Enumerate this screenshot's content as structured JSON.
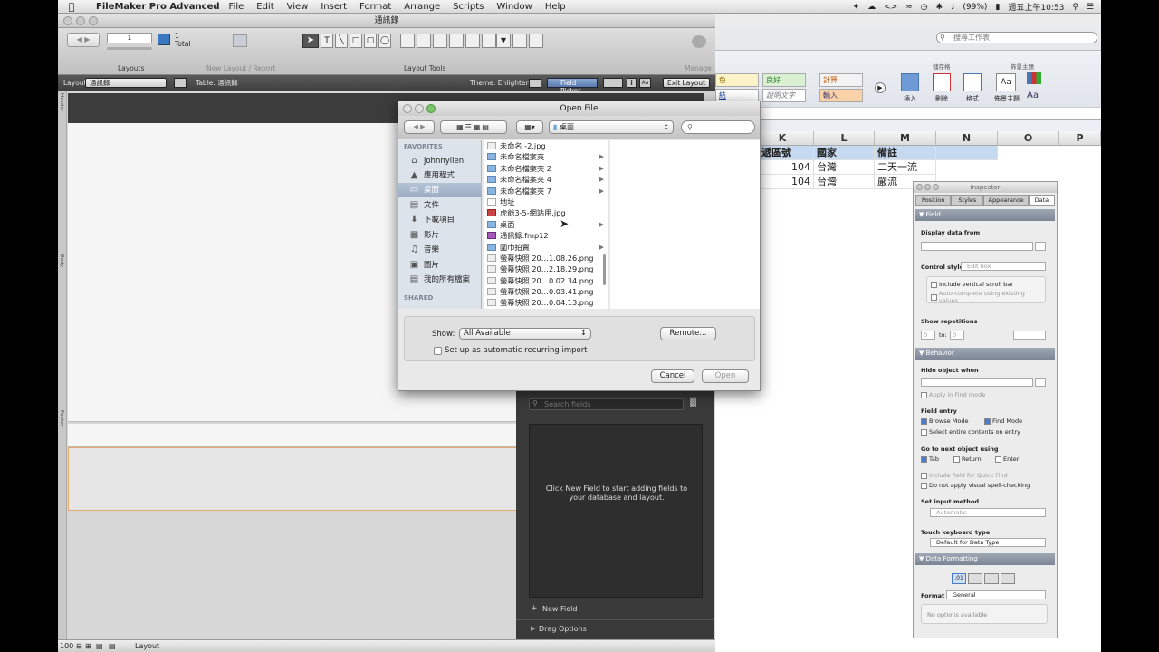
{
  "menubar": {
    "app_name": "FileMaker Pro Advanced",
    "items": [
      "File",
      "Edit",
      "View",
      "Insert",
      "Format",
      "Arrange",
      "Scripts",
      "Window",
      "Help"
    ],
    "battery": "(99%)",
    "clock": "週五上午10:53"
  },
  "fm_window": {
    "title": "通訊錄",
    "layout_count": "1",
    "total_label": "Total",
    "layouts_label": "Layouts",
    "new_layout_label": "New Layout / Report",
    "layout_tools_label": "Layout Tools",
    "manage_label": "Manage",
    "layout_bar": {
      "layout_label": "Layout:",
      "layout_value": "通訊錄",
      "table_label": "Table: 通訊錄",
      "theme_label": "Theme: Enlightened",
      "field_picker_label": "Field Picker",
      "exit_layout_label": "Exit Layout"
    },
    "part_labels": {
      "header": "Header",
      "body": "Body",
      "footer": "Footer"
    },
    "status": {
      "zoom": "100",
      "mode": "Layout"
    }
  },
  "excel": {
    "search_placeholder": "搜尋工作表",
    "styles": [
      [
        "色",
        "良好",
        "計算"
      ],
      [
        "結",
        "說明文字",
        "輸入"
      ]
    ],
    "ribbon_groups": {
      "cells": "儲存格",
      "themes": "佈景主題"
    },
    "ribbon_buttons": [
      "插入",
      "刪除",
      "格式",
      "佈景主題"
    ],
    "columns": [
      "K",
      "L",
      "M",
      "N",
      "O",
      "P"
    ],
    "header_row": [
      "郵遞區號",
      "國家",
      "備註"
    ],
    "rows": [
      [
        "104",
        "台灣",
        "二天一流"
      ],
      [
        "104",
        "台灣",
        "嚴流"
      ]
    ]
  },
  "inspector": {
    "title": "Inspector",
    "tabs": [
      "Position",
      "Styles",
      "Appearance",
      "Data"
    ],
    "active_tab": "Data",
    "field_section": "Field",
    "display_data_from": "Display data from",
    "control_style_label": "Control style",
    "control_style_value": "Edit box",
    "include_scroll": "Include vertical scroll bar",
    "autocomplete": "Auto-complete using existing values",
    "show_repetitions": "Show repetitions",
    "rep_from": "0",
    "rep_to_label": "to:",
    "rep_to": "0",
    "behavior_section": "Behavior",
    "hide_when": "Hide object when",
    "apply_find": "Apply in Find mode",
    "field_entry": "Field entry",
    "browse_mode": "Browse Mode",
    "find_mode": "Find Mode",
    "select_entire": "Select entire contents on entry",
    "go_next": "Go to next object using",
    "tab": "Tab",
    "return": "Return",
    "enter": "Enter",
    "include_quick_find": "Include field for Quick Find",
    "no_spell": "Do not apply visual spell-checking",
    "set_input": "Set input method",
    "input_value": "Automatic",
    "touch_kb": "Touch keyboard type",
    "touch_value": "Default for Data Type",
    "data_formatting": "Data Formatting",
    "format_label": "Format",
    "format_value": "General",
    "no_options": "No options available"
  },
  "field_picker": {
    "search_placeholder": "Search fields",
    "empty_message": "Click New Field to start adding fields to your database and layout.",
    "new_field": "New Field",
    "drag_options": "Drag Options"
  },
  "dialog": {
    "title": "Open File",
    "location": "桌面",
    "favorites_header": "FAVORITES",
    "shared_header": "SHARED",
    "sidebar": [
      {
        "label": "johnnylien",
        "icon": "home-icon"
      },
      {
        "label": "應用程式",
        "icon": "apps-icon"
      },
      {
        "label": "桌面",
        "icon": "desktop-icon"
      },
      {
        "label": "文件",
        "icon": "documents-icon"
      },
      {
        "label": "下載項目",
        "icon": "downloads-icon"
      },
      {
        "label": "影片",
        "icon": "movies-icon"
      },
      {
        "label": "音樂",
        "icon": "music-icon"
      },
      {
        "label": "圖片",
        "icon": "pictures-icon"
      },
      {
        "label": "我的所有檔案",
        "icon": "all-files-icon"
      }
    ],
    "files": [
      {
        "name": "未命名 -2.jpg",
        "type": "image",
        "folder": false
      },
      {
        "name": "未命名檔案夾",
        "type": "folder",
        "folder": true
      },
      {
        "name": "未命名檔案夾 2",
        "type": "folder",
        "folder": true
      },
      {
        "name": "未命名檔案夾 4",
        "type": "folder",
        "folder": true
      },
      {
        "name": "未命名檔案夾 7",
        "type": "folder",
        "folder": true
      },
      {
        "name": "地址",
        "type": "doc",
        "folder": false
      },
      {
        "name": "虎爺3-5-網站用.jpg",
        "type": "image",
        "folder": false
      },
      {
        "name": "桌面",
        "type": "folder",
        "folder": true
      },
      {
        "name": "通訊錄.fmp12",
        "type": "fmp",
        "folder": false
      },
      {
        "name": "圍巾拍賣",
        "type": "folder",
        "folder": true
      },
      {
        "name": "螢幕快照 20…1.08.26.png",
        "type": "image",
        "folder": false
      },
      {
        "name": "螢幕快照 20…2.18.29.png",
        "type": "image",
        "folder": false
      },
      {
        "name": "螢幕快照 20…0.02.34.png",
        "type": "image",
        "folder": false
      },
      {
        "name": "螢幕快照 20…0.03.41.png",
        "type": "image",
        "folder": false
      },
      {
        "name": "螢幕快照 20…0.04.13.png",
        "type": "image",
        "folder": false
      }
    ],
    "show_label": "Show:",
    "show_value": "All Available",
    "remote_label": "Remote...",
    "recurring_label": "Set up as automatic recurring import",
    "cancel_label": "Cancel",
    "open_label": "Open"
  }
}
